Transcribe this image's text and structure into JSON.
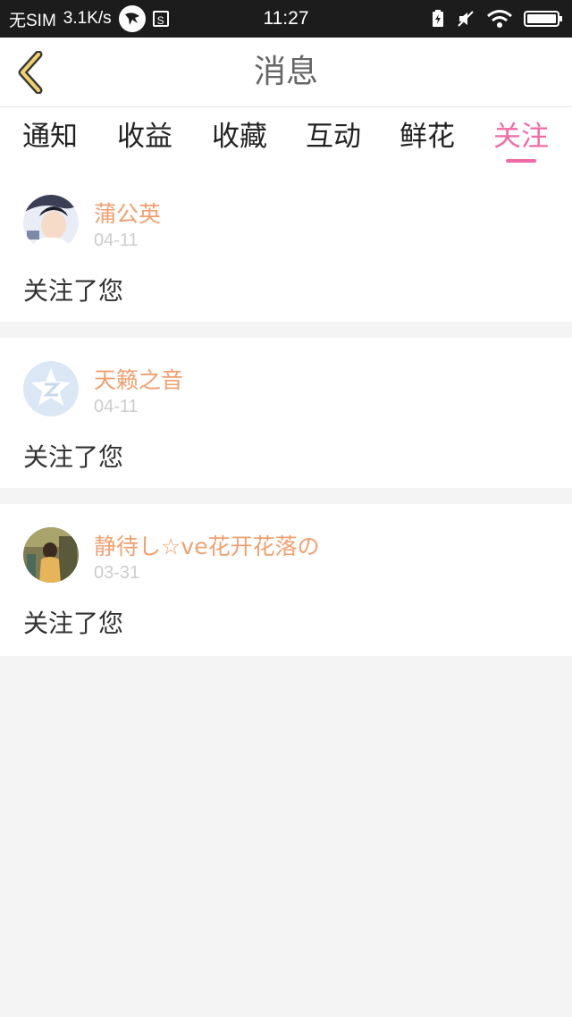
{
  "status_bar": {
    "carrier": "无SIM",
    "speed": "3.1K/s",
    "time": "11:27"
  },
  "header": {
    "title": "消息"
  },
  "tabs": [
    {
      "label": "通知"
    },
    {
      "label": "收益"
    },
    {
      "label": "收藏"
    },
    {
      "label": "互动"
    },
    {
      "label": "鲜花"
    },
    {
      "label": "关注"
    }
  ],
  "active_tab": "关注",
  "notifications": [
    {
      "username": "蒲公英",
      "date": "04-11",
      "message": "关注了您"
    },
    {
      "username": "天籁之音",
      "date": "04-11",
      "message": "关注了您"
    },
    {
      "username": "静待し☆ve花开花落の",
      "date": "03-31",
      "message": "关注了您"
    }
  ],
  "colors": {
    "accent": "#f06ba6",
    "username": "#f0a070",
    "date": "#cccccc",
    "status_bar": "#1c1c1c"
  }
}
